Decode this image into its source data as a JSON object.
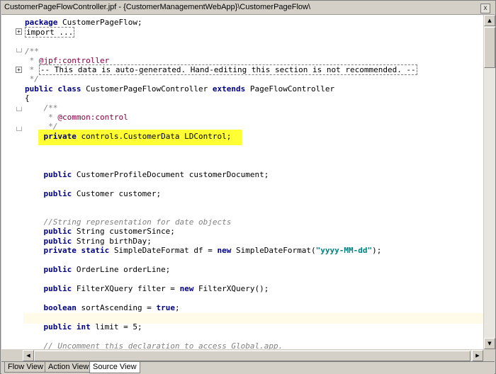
{
  "window": {
    "title": "CustomerPageFlowController.jpf - {CustomerManagementWebApp}\\CustomerPageFlow\\",
    "close_glyph": "x"
  },
  "code": {
    "l1_kw": "package",
    "l1_rest": " CustomerPageFlow;",
    "l2": "import ...",
    "l3": "/**",
    "l4_a": " * ",
    "l4_b": "@jpf:controller",
    "l5_a": " * ",
    "l5_b": "-- This data is auto-generated. Hand-editing this section is not recommended. --",
    "l6": " */",
    "l7_kw1": "public class",
    "l7_mid": " CustomerPageFlowController ",
    "l7_kw2": "extends",
    "l7_rest": " PageFlowController",
    "l8": "{",
    "l9": "    /**",
    "l10_a": "     * ",
    "l10_b": "@common:control",
    "l11": "     */",
    "l12_kw": "    private",
    "l12_rest": " controls.CustomerData LDControl;",
    "l13_kw": "    public",
    "l13_rest": " CustomerProfileDocument customerDocument;",
    "l14_kw": "    public",
    "l14_rest": " Customer customer;",
    "l15": "    //String representation for date objects",
    "l16_kw": "    public",
    "l16_rest": " String customerSince;",
    "l17_kw": "    public",
    "l17_rest": " String birthDay;",
    "l18_kw1": "    private static",
    "l18_mid": " SimpleDateFormat df = ",
    "l18_kw2": "new",
    "l18_mid2": " SimpleDateFormat(",
    "l18_str": "\"yyyy-MM-dd\"",
    "l18_end": ");",
    "l19_kw": "    public",
    "l19_rest": " OrderLine orderLine;",
    "l20_kw": "    public",
    "l20_mid": " FilterXQuery filter = ",
    "l20_kw2": "new",
    "l20_rest": " FilterXQuery();",
    "l21_kw": "    boolean",
    "l21_mid": " sortAscending = ",
    "l21_kw2": "true",
    "l21_rest": ";",
    "l22_kw1": "    public",
    "l22_kw2": " int",
    "l22_rest": " limit = 5;",
    "l23": "    // Uncomment this declaration to access Global.app."
  },
  "gutter": {
    "expand_glyph": "+"
  },
  "scrollbars": {
    "up": "▲",
    "down": "▼",
    "left": "◀",
    "right": "▶"
  },
  "tabs": [
    {
      "label": "Flow View"
    },
    {
      "label": "Action View"
    },
    {
      "label": "Source View"
    }
  ],
  "colors": {
    "highlight": "#ffff33",
    "keyword": "#000080",
    "comment": "#808080",
    "annotation": "#800040",
    "string": "#008080"
  }
}
